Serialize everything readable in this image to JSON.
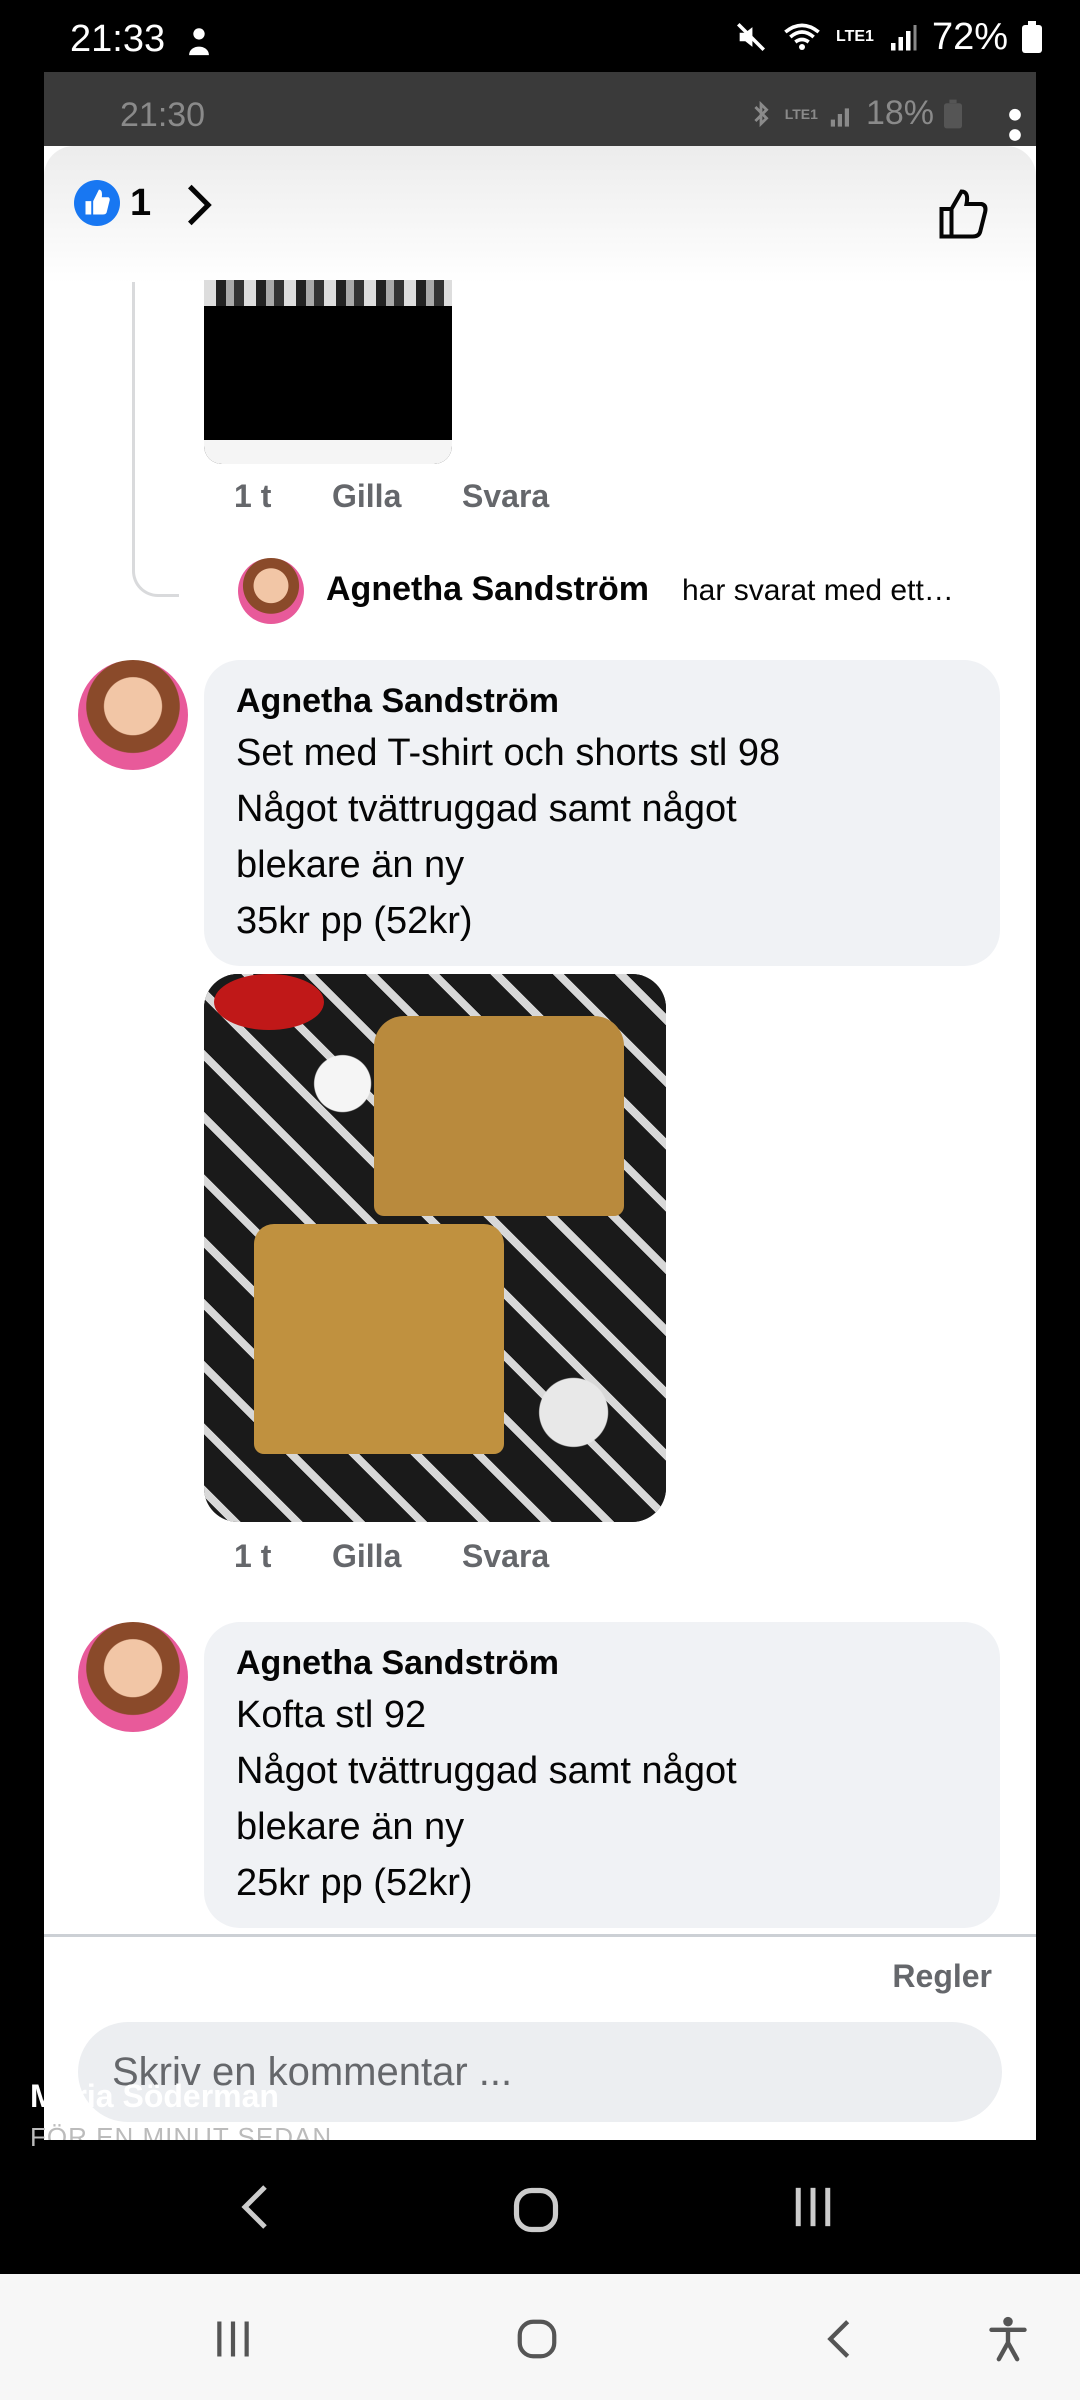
{
  "outer_status": {
    "time": "21:33",
    "battery_pct": "72%",
    "network_label": "LTE1"
  },
  "inner_status": {
    "time": "21:30",
    "battery_pct": "18%",
    "network_label": "LTE1"
  },
  "reactions": {
    "like_count": "1"
  },
  "first_meta": {
    "time": "1 t",
    "like": "Gilla",
    "reply": "Svara"
  },
  "reply_preview": {
    "name": "Agnetha Sandström",
    "text": "har svarat med ett…"
  },
  "comments": [
    {
      "name": "Agnetha Sandström",
      "lines": [
        "Set med T-shirt och shorts stl 98",
        "Något tvättruggad samt något",
        "blekare än ny",
        "35kr pp (52kr)"
      ],
      "meta": {
        "time": "1 t",
        "like": "Gilla",
        "reply": "Svara"
      }
    },
    {
      "name": "Agnetha Sandström",
      "lines": [
        "Kofta stl 92",
        "Något tvättruggad samt något",
        "blekare än ny",
        "25kr pp (52kr)"
      ]
    }
  ],
  "footer": {
    "rules": "Regler",
    "comment_placeholder": "Skriv en kommentar ..."
  },
  "story_overlay": {
    "author": "Maria Söderman",
    "time": "FÖR EN MINUT SEDAN"
  },
  "colors": {
    "like_blue": "#1877f2",
    "bubble_bg": "#f0f2f5",
    "meta_gray": "#65676b"
  },
  "icons": [
    "like-badge-icon",
    "chevron-right-icon",
    "thumbs-up-outline-icon",
    "more-vert-icon",
    "back-icon",
    "home-icon",
    "recents-icon",
    "accessibility-icon"
  ]
}
